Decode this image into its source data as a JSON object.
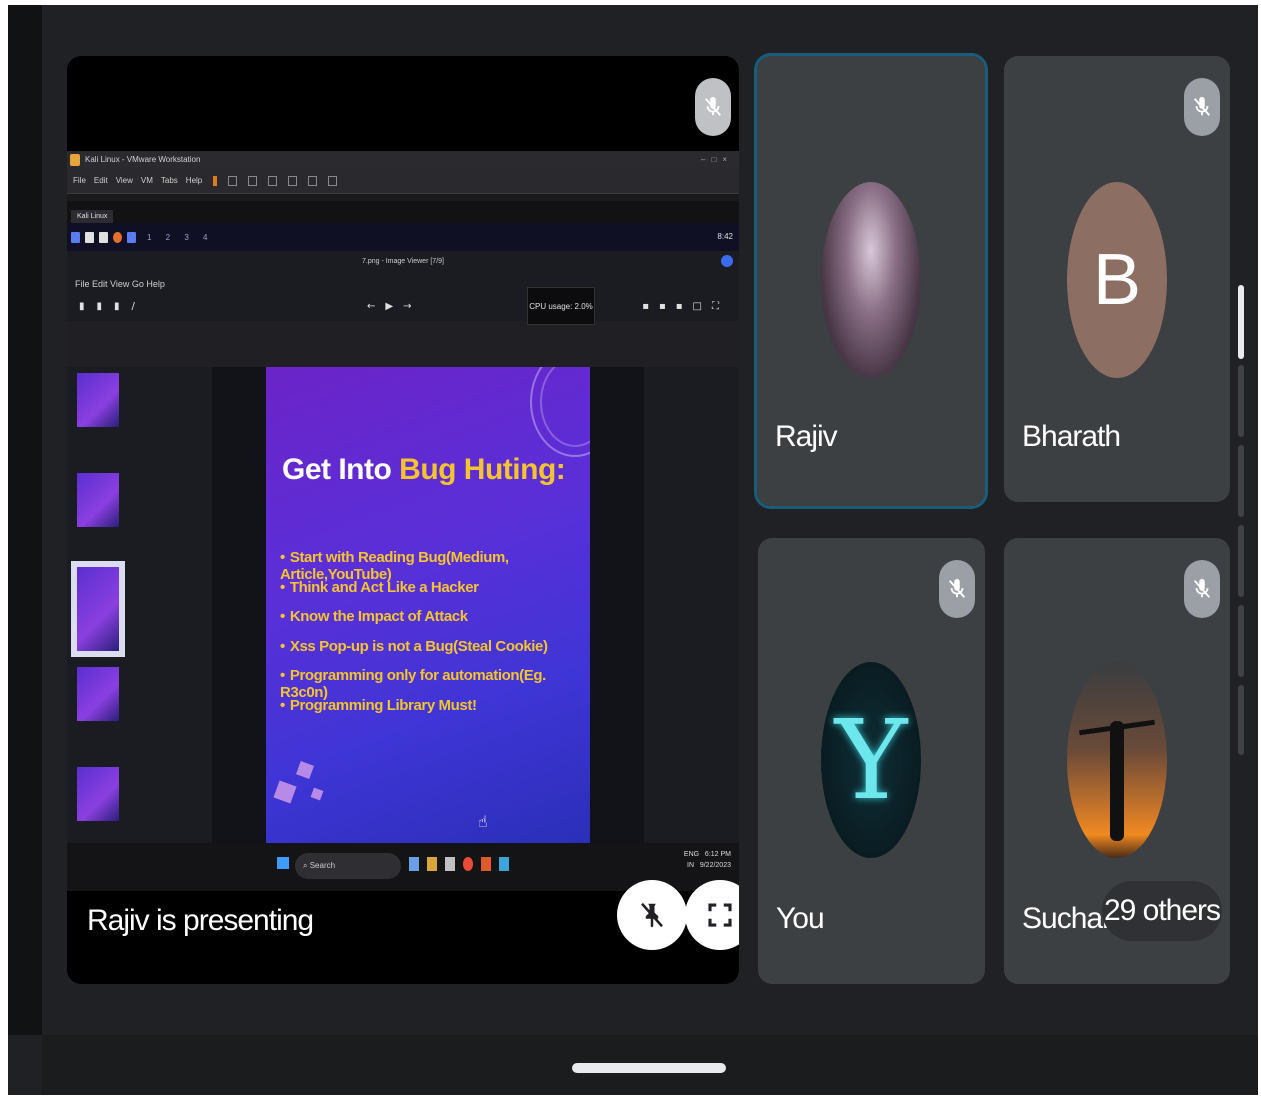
{
  "presenter": {
    "label": "Rajiv is presenting",
    "mic_state": "muted",
    "shared_screen": {
      "vm_window_title": "Kali Linux - VMware Workstation",
      "vm_menu": [
        "File",
        "Edit",
        "View",
        "VM",
        "Tabs",
        "Help"
      ],
      "vm_tab": "Kali Linux",
      "workspaces": "1 2 3 4",
      "panel_time": "8:42",
      "viewer_title": "7.png - Image Viewer [7/9]",
      "cpu_tooltip": "CPU usage: 2.0%",
      "viewer_menu": "File  Edit  View  Go  Help",
      "slide": {
        "title_plain": "Get Into ",
        "title_highlight": "Bug Huting:",
        "bullets": [
          "Start with Reading Bug(Medium, Article,YouTube)",
          "Think and Act Like a Hacker",
          "Know the Impact of Attack",
          "Xss Pop-up is not a Bug(Steal Cookie)",
          "Programming only for automation(Eg. R3c0n)",
          "Programming Library Must!"
        ]
      },
      "taskbar": {
        "search_placeholder": "Search",
        "lang": "ENG",
        "region": "IN",
        "time": "6:12 PM",
        "date": "9/22/2023"
      }
    }
  },
  "participants": [
    {
      "name": "Rajiv",
      "avatar": "photo",
      "mic_state": "unmuted",
      "active": true
    },
    {
      "name": "Bharath",
      "avatar": "letter",
      "initial": "B",
      "mic_state": "muted"
    },
    {
      "name": "You",
      "avatar": "photo",
      "initial": "Y",
      "mic_state": "muted"
    },
    {
      "name": "Sucharit",
      "avatar": "photo",
      "mic_state": "muted"
    }
  ],
  "others_chip": "29 others",
  "colors": {
    "background": "#202124",
    "tile": "#3c4043",
    "active_outline": "#1a5d7a",
    "slide_highlight": "#f4c430",
    "avatar_b": "#8d6e63"
  }
}
